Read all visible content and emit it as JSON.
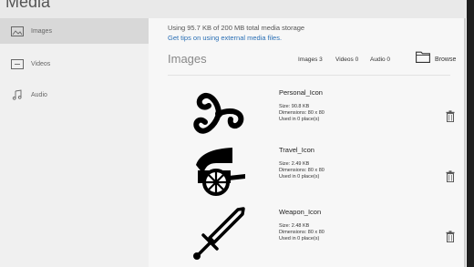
{
  "window": {
    "title": "Media"
  },
  "sidebar": {
    "items": [
      {
        "label": "Images",
        "icon": "image-icon",
        "active": true
      },
      {
        "label": "Videos",
        "icon": "video-icon",
        "active": false
      },
      {
        "label": "Audio",
        "icon": "music-note-icon",
        "active": false
      }
    ]
  },
  "main": {
    "storage_text": "Using 95.7 KB of 200 MB total media storage",
    "tips_link": "Get tips on using external media files.",
    "section_title": "Images",
    "counts": {
      "images": "Images 3",
      "videos": "Videos 0",
      "audio": "Audio 0"
    },
    "browse_label": "Browse",
    "items": [
      {
        "name": "Personal_Icon",
        "size": "Size: 90.8 KB",
        "dimensions": "Dimensions: 80 x 80",
        "usage": "Used in 0 place(s)",
        "icon": "triskelion-icon"
      },
      {
        "name": "Travel_Icon",
        "size": "Size: 2.49 KB",
        "dimensions": "Dimensions: 80 x 80",
        "usage": "Used in 0 place(s)",
        "icon": "cart-icon"
      },
      {
        "name": "Weapon_Icon",
        "size": "Size: 2.48 KB",
        "dimensions": "Dimensions: 80 x 80",
        "usage": "Used in 0 place(s)",
        "icon": "sword-icon"
      }
    ]
  },
  "colors": {
    "link": "#2a6fb5",
    "active_item": "#d8d8d8",
    "sidebar_bg": "#f0f0f0",
    "main_bg": "#f7f7f7"
  }
}
